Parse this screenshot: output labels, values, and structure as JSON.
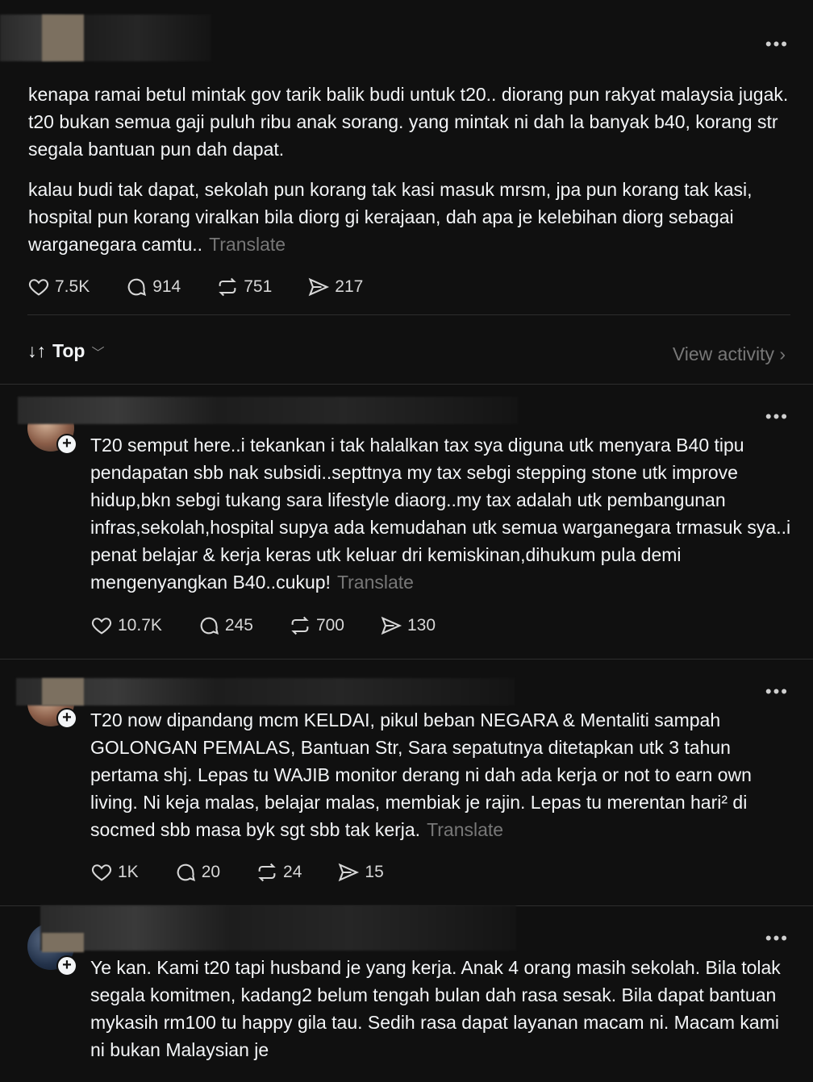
{
  "posts": [
    {
      "paragraphs": [
        "kenapa ramai betul mintak gov tarik balik budi untuk t20.. diorang pun rakyat malaysia jugak. t20 bukan semua gaji puluh ribu anak sorang. yang mintak ni dah la banyak b40, korang str segala bantuan pun dah dapat.",
        "kalau budi tak dapat, sekolah pun korang tak kasi masuk mrsm, jpa pun korang tak kasi, hospital pun korang viralkan bila diorg gi kerajaan, dah apa je kelebihan diorg sebagai warganegara camtu.."
      ],
      "translate": "Translate",
      "likes": "7.5K",
      "replies": "914",
      "reposts": "751",
      "shares": "217"
    }
  ],
  "sort": {
    "label": "Top",
    "view_activity": "View activity ›"
  },
  "replies": [
    {
      "text": "T20 semput here..i tekankan i tak halalkan tax sya diguna utk menyara B40 tipu pendapatan sbb nak subsidi..septtnya my tax sebgi stepping stone utk improve hidup,bkn sebgi tukang sara lifestyle diaorg..my tax adalah utk pembangunan infras,sekolah,hospital supya ada kemudahan utk semua warganegara trmasuk sya..i penat belajar & kerja keras utk keluar dri kemiskinan,dihukum pula demi mengenyangkan B40..cukup!",
      "translate": "Translate",
      "likes": "10.7K",
      "replies": "245",
      "reposts": "700",
      "shares": "130"
    },
    {
      "text": "T20 now dipandang mcm KELDAI, pikul beban NEGARA & Mentaliti sampah GOLONGAN PEMALAS, Bantuan Str, Sara sepatutnya ditetapkan utk 3 tahun pertama shj. Lepas tu WAJIB monitor derang ni dah ada kerja or not to earn own living. Ni keja malas, belajar malas, membiak je rajin. Lepas tu merentan hari² di socmed sbb masa byk sgt sbb tak kerja.",
      "translate": "Translate",
      "likes": "1K",
      "replies": "20",
      "reposts": "24",
      "shares": "15"
    },
    {
      "text": "Ye kan. Kami t20 tapi husband je yang kerja. Anak 4 orang masih sekolah. Bila tolak segala komitmen, kadang2 belum tengah bulan dah rasa sesak. Bila dapat bantuan mykasih rm100 tu happy gila tau. Sedih rasa dapat layanan macam ni. Macam kami ni bukan Malaysian je"
    }
  ],
  "more_label": "•••",
  "icons": [
    "heart-icon",
    "comment-icon",
    "repost-icon",
    "share-icon",
    "sort-icon",
    "chevron-down-icon",
    "follow-plus-icon",
    "more-icon"
  ]
}
